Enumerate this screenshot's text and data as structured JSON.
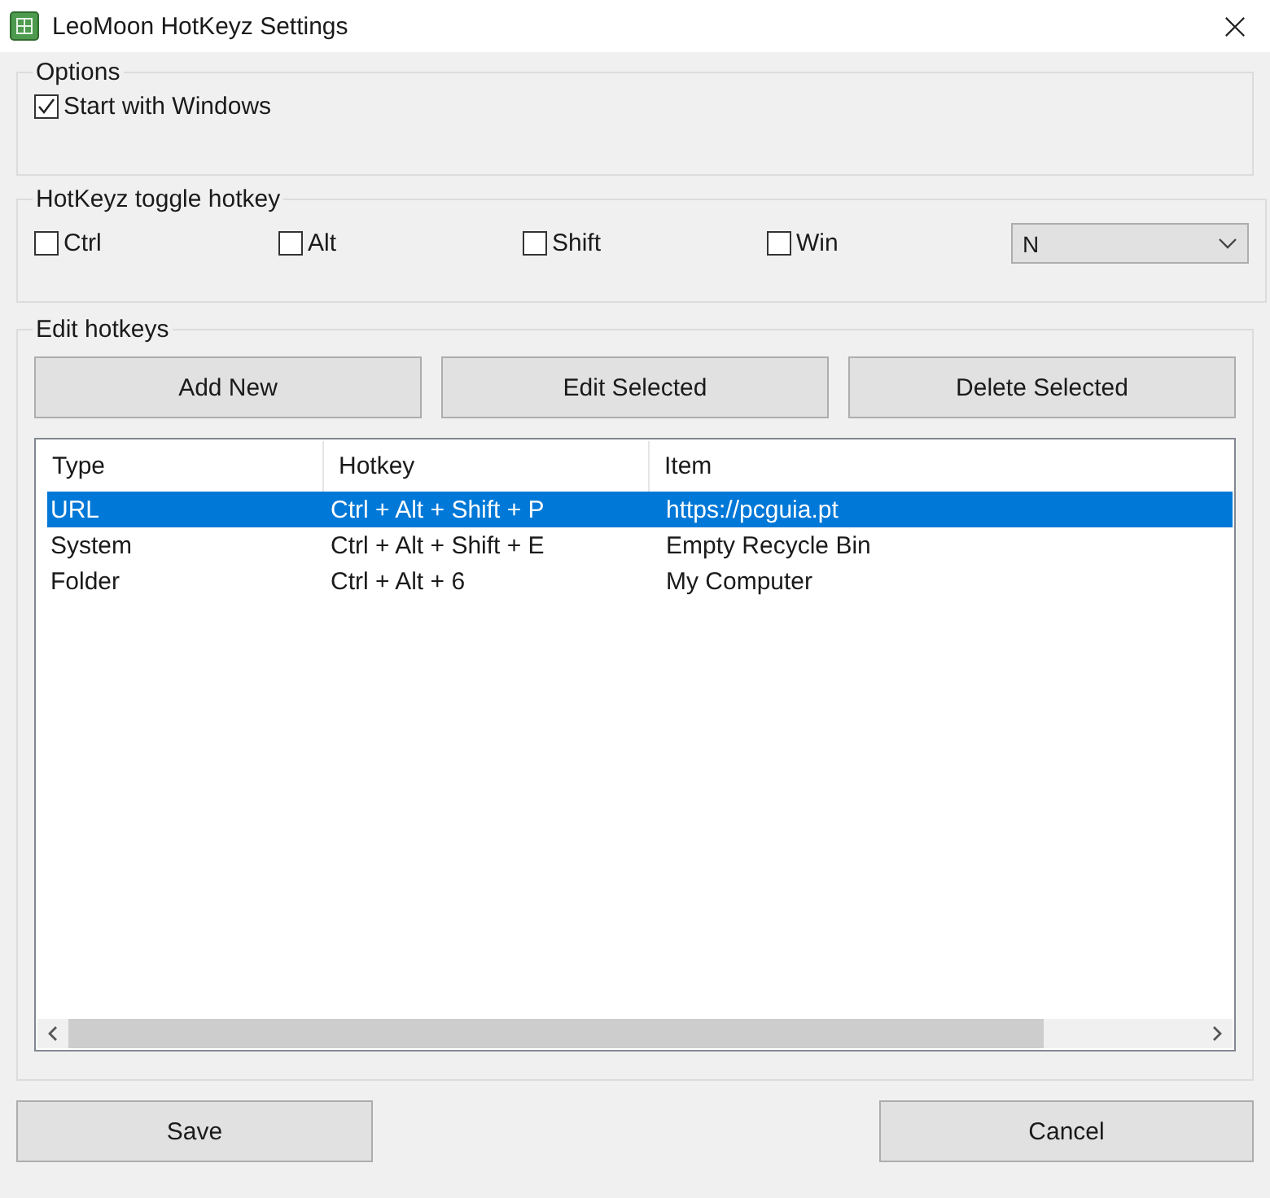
{
  "window": {
    "title": "LeoMoon HotKeyz Settings"
  },
  "options": {
    "title": "Options",
    "checkboxes": [
      {
        "label": "Start with Windows",
        "checked": true
      }
    ]
  },
  "toggle_hotkey": {
    "title": "HotKeyz toggle hotkey",
    "modifiers": [
      {
        "label": "Ctrl",
        "checked": false
      },
      {
        "label": "Alt",
        "checked": false
      },
      {
        "label": "Shift",
        "checked": false
      },
      {
        "label": "Win",
        "checked": false
      }
    ],
    "key_dropdown": {
      "value": "N"
    }
  },
  "edit_hotkeys": {
    "title": "Edit hotkeys",
    "buttons": [
      "Add New",
      "Edit Selected",
      "Delete Selected"
    ],
    "table": {
      "columns": [
        "Type",
        "Hotkey",
        "Item"
      ],
      "rows": [
        {
          "cells": [
            "URL",
            "Ctrl + Alt + Shift + P",
            "https://pcguia.pt"
          ],
          "selected": true
        },
        {
          "cells": [
            "System",
            "Ctrl + Alt + Shift + E",
            "Empty Recycle Bin"
          ],
          "selected": false
        },
        {
          "cells": [
            "Folder",
            "Ctrl + Alt + 6",
            "My Computer"
          ],
          "selected": false
        }
      ]
    }
  },
  "footer_buttons": [
    "Save",
    "Cancel"
  ]
}
